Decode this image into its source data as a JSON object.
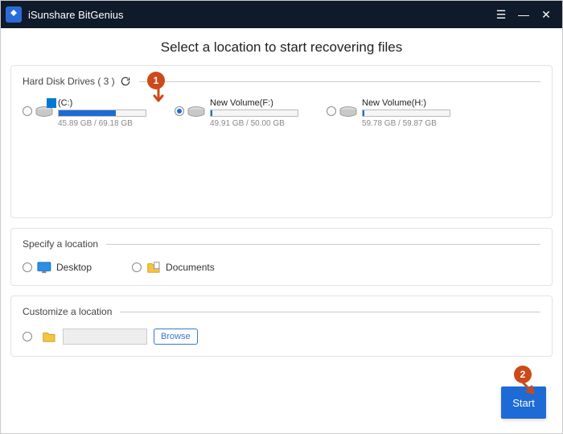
{
  "titlebar": {
    "app_name": "iSunshare BitGenius",
    "logo_glyph": "↺",
    "menu_icon": "☰",
    "minimize": "—",
    "close": "✕"
  },
  "heading": "Select a location to start recovering files",
  "sections": {
    "drives_label": "Hard Disk Drives ( 3 )",
    "specify_label": "Specify a location",
    "customize_label": "Customize a location"
  },
  "drives": [
    {
      "name": "(C:)",
      "size": "45.89 GB / 69.18 GB",
      "fill_pct": 66,
      "selected": false,
      "has_win": true
    },
    {
      "name": "New Volume(F:)",
      "size": "49.91 GB / 50.00 GB",
      "fill_pct": 2,
      "selected": true,
      "has_win": false
    },
    {
      "name": "New Volume(H:)",
      "size": "59.78 GB / 59.87 GB",
      "fill_pct": 2,
      "selected": false,
      "has_win": false
    }
  ],
  "locations": {
    "desktop": "Desktop",
    "documents": "Documents"
  },
  "customize": {
    "browse_label": "Browse",
    "path_value": ""
  },
  "start_button": "Start",
  "annotations": {
    "step1": "1",
    "step2": "2"
  }
}
